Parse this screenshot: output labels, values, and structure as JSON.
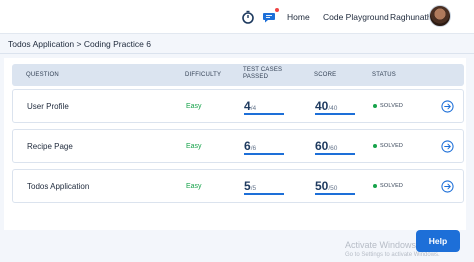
{
  "header": {
    "nav_home": "Home",
    "nav_playground": "Code Playground",
    "user_name": "Raghunath",
    "icons": [
      "timer-icon",
      "chat-icon",
      "avatar"
    ]
  },
  "breadcrumb": "Todos Application > Coding Practice 6",
  "table": {
    "headers": {
      "question": "QUESTION",
      "difficulty": "DIFFICULTY",
      "tests_line1": "TEST CASES",
      "tests_line2": "PASSED",
      "score": "SCORE",
      "status": "STATUS"
    },
    "rows": [
      {
        "question": "User Profile",
        "difficulty": "Easy",
        "tests_passed": "4",
        "tests_total": "/4",
        "score": "40",
        "score_total": "/40",
        "status": "SOLVED"
      },
      {
        "question": "Recipe Page",
        "difficulty": "Easy",
        "tests_passed": "6",
        "tests_total": "/6",
        "score": "60",
        "score_total": "/60",
        "status": "SOLVED"
      },
      {
        "question": "Todos Application",
        "difficulty": "Easy",
        "tests_passed": "5",
        "tests_total": "/5",
        "score": "50",
        "score_total": "/50",
        "status": "SOLVED"
      }
    ]
  },
  "overlay": {
    "watermark_title": "Activate Windows",
    "watermark_sub": "Go to Settings to activate Windows.",
    "help_label": "Help"
  },
  "colors": {
    "accent": "#1d6fd8",
    "easy": "#16a34a",
    "header_bg": "#dbe4f0",
    "page_bg": "#f3f6fb"
  }
}
